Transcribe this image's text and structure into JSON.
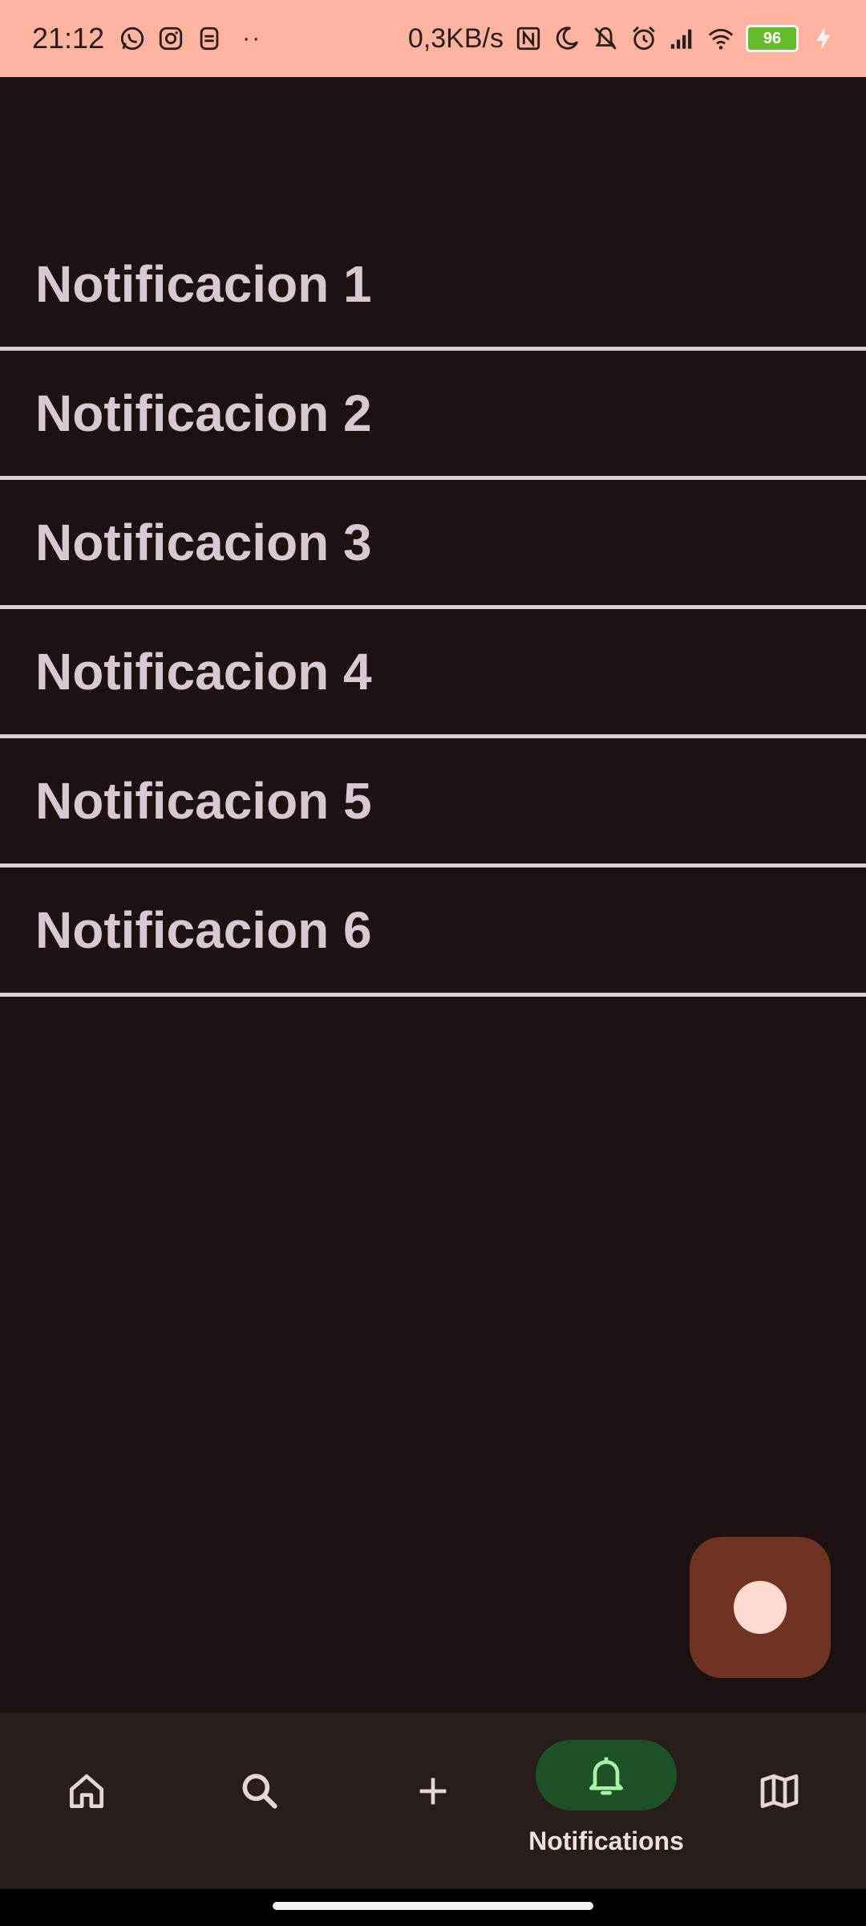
{
  "status_bar": {
    "time": "21:12",
    "more_indicator": "··",
    "net_speed": "0,3KB/s",
    "battery_level": "96",
    "icons": [
      "whatsapp-icon",
      "instagram-icon",
      "app-icon",
      "nfc-icon",
      "moon-icon",
      "vibrate-off-icon",
      "alarm-icon",
      "signal-icon",
      "wifi-icon",
      "battery-icon",
      "charging-icon"
    ]
  },
  "notifications": {
    "items": [
      {
        "label": "Notificacion 1"
      },
      {
        "label": "Notificacion 2"
      },
      {
        "label": "Notificacion 3"
      },
      {
        "label": "Notificacion 4"
      },
      {
        "label": "Notificacion 5"
      },
      {
        "label": "Notificacion 6"
      }
    ]
  },
  "fab": {
    "icon": "record-icon"
  },
  "bottom_nav": {
    "active_label": "Notifications",
    "items": [
      "home-icon",
      "search-icon",
      "add-icon",
      "bell-icon",
      "map-icon"
    ]
  },
  "colors": {
    "status_bar_bg": "#ffb4a1",
    "background": "#1b1211",
    "item_text": "#d9c8d4",
    "divider": "#d8d2d0",
    "fab_bg": "#6e3323",
    "fab_dot": "#ffdad0",
    "nav_bg": "#271e1c",
    "nav_active_bg": "#1f5127",
    "nav_active_icon": "#a6f2a8"
  }
}
